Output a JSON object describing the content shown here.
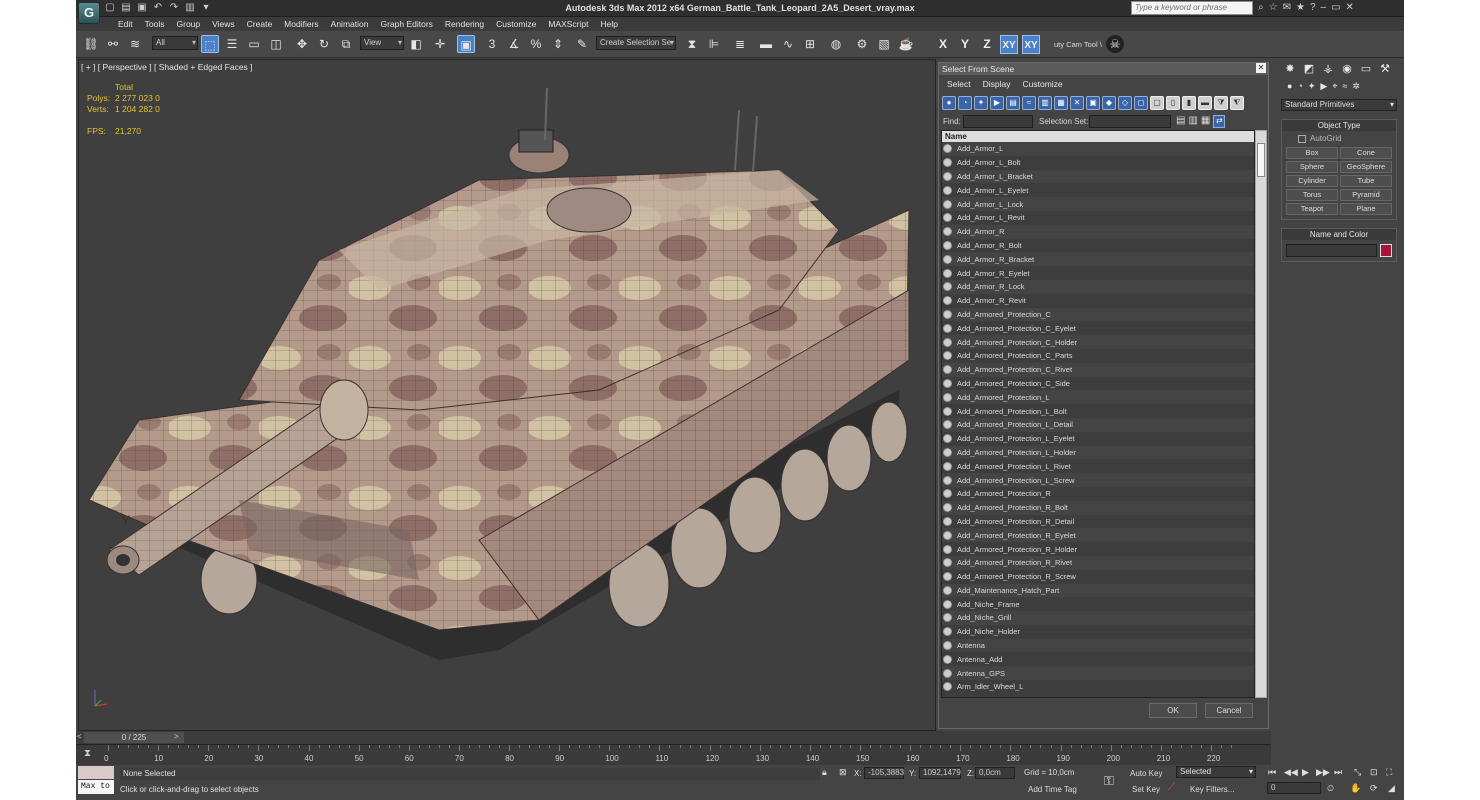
{
  "app": {
    "title": "Autodesk 3ds Max  2012 x64     German_Battle_Tank_Leopard_2A5_Desert_vray.max",
    "logo": "G",
    "search_placeholder": "Type a keyword or phrase"
  },
  "menu": [
    "Edit",
    "Tools",
    "Group",
    "Views",
    "Create",
    "Modifiers",
    "Animation",
    "Graph Editors",
    "Rendering",
    "Customize",
    "MAXScript",
    "Help"
  ],
  "toolbar": {
    "filter_value": "All",
    "refcoord_value": "View",
    "selection_set_placeholder": "Create Selection Se",
    "snap_label": "3",
    "angle_label": "n",
    "axes": [
      "X",
      "Y",
      "Z",
      "XY",
      "XY"
    ],
    "cam_tool": "uty Cam Tool \\"
  },
  "viewport": {
    "label": "[ + ] [ Perspective ] [ Shaded + Edged Faces ]",
    "stats_header": "Total",
    "polys_label": "Polys:",
    "polys_value": "2 277 023  0",
    "verts_label": "Verts:",
    "verts_value": "1 204 282  0",
    "fps_label": "FPS:",
    "fps_value": "21,270",
    "model_marking": "Y"
  },
  "select_from_scene": {
    "title": "Select From Scene",
    "menu": [
      "Select",
      "Display",
      "Customize"
    ],
    "find_label": "Find:",
    "selection_set_label": "Selection Set:",
    "column_name": "Name",
    "items": [
      "Add_Armor_L",
      "Add_Armor_L_Bolt",
      "Add_Armor_L_Bracket",
      "Add_Armor_L_Eyelet",
      "Add_Armor_L_Lock",
      "Add_Armor_L_Revit",
      "Add_Armor_R",
      "Add_Armor_R_Bolt",
      "Add_Armor_R_Bracket",
      "Add_Armor_R_Eyelet",
      "Add_Armor_R_Lock",
      "Add_Armor_R_Revit",
      "Add_Armored_Protection_C",
      "Add_Armored_Protection_C_Eyelet",
      "Add_Armored_Protection_C_Holder",
      "Add_Armored_Protection_C_Parts",
      "Add_Armored_Protection_C_Rivet",
      "Add_Armored_Protection_C_Side",
      "Add_Armored_Protection_L",
      "Add_Armored_Protection_L_Bolt",
      "Add_Armored_Protection_L_Detail",
      "Add_Armored_Protection_L_Eyelet",
      "Add_Armored_Protection_L_Holder",
      "Add_Armored_Protection_L_Rivet",
      "Add_Armored_Protection_L_Screw",
      "Add_Armored_Protection_R",
      "Add_Armored_Protection_R_Bolt",
      "Add_Armored_Protection_R_Detail",
      "Add_Armored_Protection_R_Eyelet",
      "Add_Armored_Protection_R_Holder",
      "Add_Armored_Protection_R_Rivet",
      "Add_Armored_Protection_R_Screw",
      "Add_Maintenance_Hatch_Part",
      "Add_Niche_Frame",
      "Add_Niche_Grill",
      "Add_Niche_Holder",
      "Antenna",
      "Antenna_Add",
      "Antenna_GPS",
      "Arm_Idler_Wheel_L"
    ],
    "ok_label": "OK",
    "cancel_label": "Cancel"
  },
  "command_panel": {
    "dropdown": "Standard Primitives",
    "object_type_title": "Object Type",
    "autogrid_label": "AutoGrid",
    "primitives": [
      "Box",
      "Cone",
      "Sphere",
      "GeoSphere",
      "Cylinder",
      "Tube",
      "Torus",
      "Pyramid",
      "Teapot",
      "Plane"
    ],
    "name_color_title": "Name and Color",
    "object_color": "#a8153c"
  },
  "timeline": {
    "slider_label": "0 / 225",
    "ticks": [
      "0",
      "10",
      "20",
      "30",
      "40",
      "50",
      "60",
      "70",
      "80",
      "90",
      "100",
      "110",
      "120",
      "130",
      "140",
      "150",
      "160",
      "170",
      "180",
      "190",
      "200",
      "210",
      "220"
    ]
  },
  "status": {
    "maxscript_label": "Max to",
    "selection_status": "None Selected",
    "prompt": "Click or click-and-drag to select objects",
    "x_label": "X:",
    "x_value": "-105,3883",
    "y_label": "Y:",
    "y_value": "1092,1479",
    "z_label": "Z:",
    "z_value": "0,0cm",
    "grid": "Grid = 10,0cm",
    "add_time_tag": "Add Time Tag",
    "auto_key": "Auto Key",
    "set_key": "Set Key",
    "key_mode_value": "Selected",
    "key_filters": "Key Filters...",
    "current_frame": "0"
  }
}
